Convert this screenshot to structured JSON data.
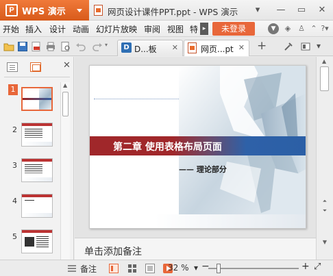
{
  "app": {
    "name": "WPS 演示",
    "window_title": "网页设计课件PPT.ppt - WPS 演示"
  },
  "menu": {
    "items": [
      "开始",
      "插入",
      "设计",
      "动画",
      "幻灯片放映",
      "审阅",
      "视图",
      "特"
    ],
    "login_label": "未登录"
  },
  "tabs": [
    {
      "label": "D...板",
      "icon": "docer-icon"
    },
    {
      "label": "网页...pt",
      "icon": "ppt-file-icon",
      "active": true
    }
  ],
  "left_panel": {
    "slides": [
      {
        "number": "1",
        "selected": true
      },
      {
        "number": "2"
      },
      {
        "number": "3"
      },
      {
        "number": "4"
      },
      {
        "number": "5"
      }
    ]
  },
  "slide": {
    "title": "第二章 使用表格布局页面",
    "subtitle": "—— 理论部分"
  },
  "notes": {
    "placeholder": "单击添加备注"
  },
  "status": {
    "notes_label": "备注",
    "zoom": "32 %"
  },
  "colors": {
    "accent": "#e8673a",
    "title_red": "#a0272a",
    "title_blue": "#2e61a8"
  }
}
